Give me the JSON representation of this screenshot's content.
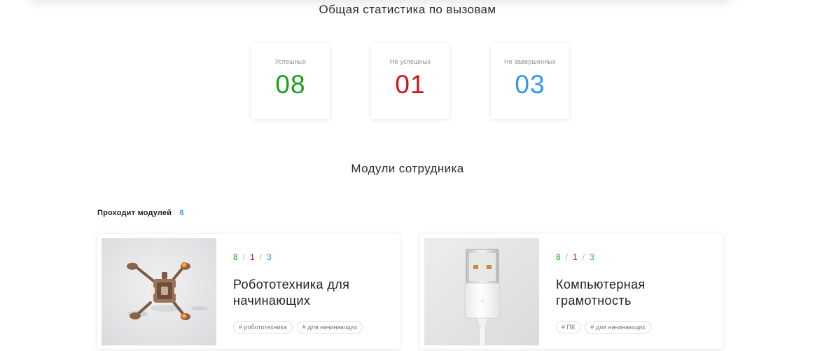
{
  "colors": {
    "success": "#1aa01a",
    "fail": "#d01414",
    "unfinished": "#3398e6"
  },
  "stats": {
    "title": "Общая статистика по вызовам",
    "cards": [
      {
        "label": "Успешных",
        "value": "08",
        "color": "#1aa01a"
      },
      {
        "label": "Не успешных",
        "value": "01",
        "color": "#d01414"
      },
      {
        "label": "Не завершенных",
        "value": "03",
        "color": "#3398e6"
      }
    ]
  },
  "modules": {
    "title": "Модули сотрудника",
    "passing_label": "Проходит модулей",
    "passing_count": "6",
    "items": [
      {
        "success": "8",
        "fail": "1",
        "unfinished": "3",
        "sep": "/",
        "title": "Робототехника для начинающих",
        "image_icon": "drone-photo",
        "tags": [
          "# робототехника",
          "# для начинающих"
        ]
      },
      {
        "success": "8",
        "fail": "1",
        "unfinished": "3",
        "sep": "/",
        "title": "Компьютерная грамотность",
        "image_icon": "usb-cable-photo",
        "tags": [
          "# ПК",
          "# для начинающих"
        ]
      }
    ]
  }
}
